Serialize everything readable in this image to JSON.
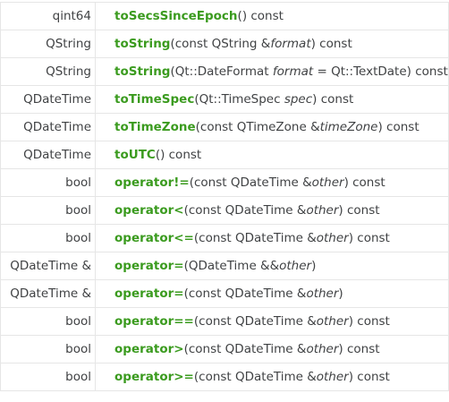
{
  "rows": [
    {
      "ret": "qint64",
      "fn": "toSecsSinceEpoch",
      "pre": "() const",
      "param": "",
      "post": ""
    },
    {
      "ret": "QString",
      "fn": "toString",
      "pre": "(const QString &",
      "param": "format",
      "post": ") const"
    },
    {
      "ret": "QString",
      "fn": "toString",
      "pre": "(Qt::DateFormat ",
      "param": "format",
      "post": " = Qt::TextDate) const"
    },
    {
      "ret": "QDateTime",
      "fn": "toTimeSpec",
      "pre": "(Qt::TimeSpec ",
      "param": "spec",
      "post": ") const"
    },
    {
      "ret": "QDateTime",
      "fn": "toTimeZone",
      "pre": "(const QTimeZone &",
      "param": "timeZone",
      "post": ") const"
    },
    {
      "ret": "QDateTime",
      "fn": "toUTC",
      "pre": "() const",
      "param": "",
      "post": ""
    },
    {
      "ret": "bool",
      "fn": "operator!=",
      "pre": "(const QDateTime &",
      "param": "other",
      "post": ") const"
    },
    {
      "ret": "bool",
      "fn": "operator<",
      "pre": "(const QDateTime &",
      "param": "other",
      "post": ") const"
    },
    {
      "ret": "bool",
      "fn": "operator<=",
      "pre": "(const QDateTime &",
      "param": "other",
      "post": ") const"
    },
    {
      "ret": "QDateTime &",
      "fn": "operator=",
      "pre": "(QDateTime &&",
      "param": "other",
      "post": ")"
    },
    {
      "ret": "QDateTime &",
      "fn": "operator=",
      "pre": "(const QDateTime &",
      "param": "other",
      "post": ")"
    },
    {
      "ret": "bool",
      "fn": "operator==",
      "pre": "(const QDateTime &",
      "param": "other",
      "post": ") const"
    },
    {
      "ret": "bool",
      "fn": "operator>",
      "pre": "(const QDateTime &",
      "param": "other",
      "post": ") const"
    },
    {
      "ret": "bool",
      "fn": "operator>=",
      "pre": "(const QDateTime &",
      "param": "other",
      "post": ") const"
    }
  ],
  "colors": {
    "function_link": "#3b9b1f",
    "text": "#404244",
    "border": "#e6e6e6"
  }
}
